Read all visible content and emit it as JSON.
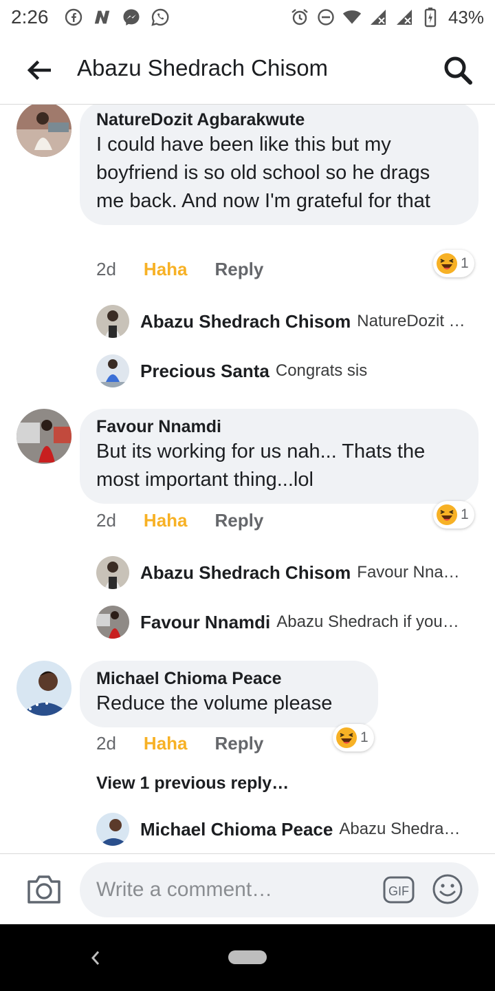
{
  "status_bar": {
    "time": "2:26",
    "battery": "43%",
    "icons_left": [
      "facebook-icon",
      "n-app-icon",
      "messenger-icon",
      "whatsapp-icon"
    ],
    "icons_right": [
      "alarm-icon",
      "do-not-disturb-icon",
      "wifi-icon",
      "signal-icon",
      "signal-icon",
      "battery-charging-icon"
    ]
  },
  "header": {
    "title": "Abazu Shedrach Chisom",
    "back_icon": "back-arrow-icon",
    "search_icon": "search-icon"
  },
  "comments": [
    {
      "author": "NatureDozit Agbarakwute",
      "text": "I could have been like this but my boyfriend is so old school so he drags me back. And now I'm grateful for that",
      "time": "2d",
      "reaction_label": "Haha",
      "reply_label": "Reply",
      "reaction_count": "1",
      "replies": [
        {
          "name": "Abazu Shedrach Chisom",
          "text": "NatureDozit …"
        },
        {
          "name": "Precious Santa",
          "text": "Congrats sis"
        }
      ]
    },
    {
      "author": "Favour Nnamdi",
      "text": "But its working for us nah... Thats the most important thing...lol",
      "time": "2d",
      "reaction_label": "Haha",
      "reply_label": "Reply",
      "reaction_count": "1",
      "replies": [
        {
          "name": "Abazu Shedrach Chisom",
          "text": "Favour Nna…"
        },
        {
          "name": "Favour Nnamdi",
          "text": "Abazu Shedrach if you…"
        }
      ]
    },
    {
      "author": "Michael Chioma Peace",
      "text": "Reduce the volume  please",
      "time": "2d",
      "reaction_label": "Haha",
      "reply_label": "Reply",
      "reaction_count": "1",
      "view_previous": "View 1 previous reply…",
      "replies": [
        {
          "name": "Michael Chioma Peace",
          "text": "Abazu Shedra…"
        }
      ]
    }
  ],
  "composer": {
    "placeholder": "Write a comment…",
    "gif_label": "GIF",
    "camera_icon": "camera-icon",
    "emoji_icon": "emoji-icon"
  },
  "colors": {
    "haha": "#f7b125",
    "bubble": "#f0f2f5",
    "muted": "#65676b"
  }
}
